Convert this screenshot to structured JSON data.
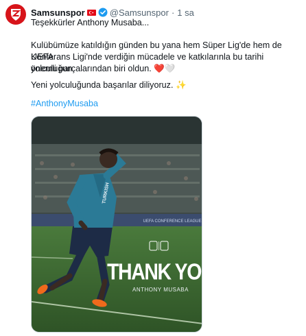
{
  "tweet": {
    "display_name": "Samsunspor",
    "handle": "@Samsunspor",
    "separator": "·",
    "time": "1 sa",
    "line1": "Teşekkürler Anthony Musaba...",
    "paragraph_line1": "Kulübümüze katıldığın günden bu yana hem Süper Lig'de hem de UEFA",
    "paragraph_line2": "Konferans Ligi'nde verdiğin mücadele ve katkılarınla bu tarihi yolculuğun",
    "paragraph_line3": "önemli parçalarından biri oldun. ❤️🤍",
    "wish": "Yeni yolculuğunda başarılar diliyoruz. ✨",
    "hashtag": "#AnthonyMusaba"
  },
  "media": {
    "thank_you": "THANK YOU",
    "player_name": "ANTHONY MUSABA",
    "board_text": "UEFA CONFERENCE LEAGUE",
    "shirt_sponsor": "TURKISH AIRLINES"
  },
  "colors": {
    "brand_red": "#d7141a",
    "link_blue": "#1d9bf0",
    "verified_blue": "#1d9bf0",
    "secondary_text": "#536471"
  },
  "icons": {
    "avatar": "samsunspor-crest-icon",
    "flag": "turkey-flag-icon",
    "verified": "verified-badge-icon"
  }
}
